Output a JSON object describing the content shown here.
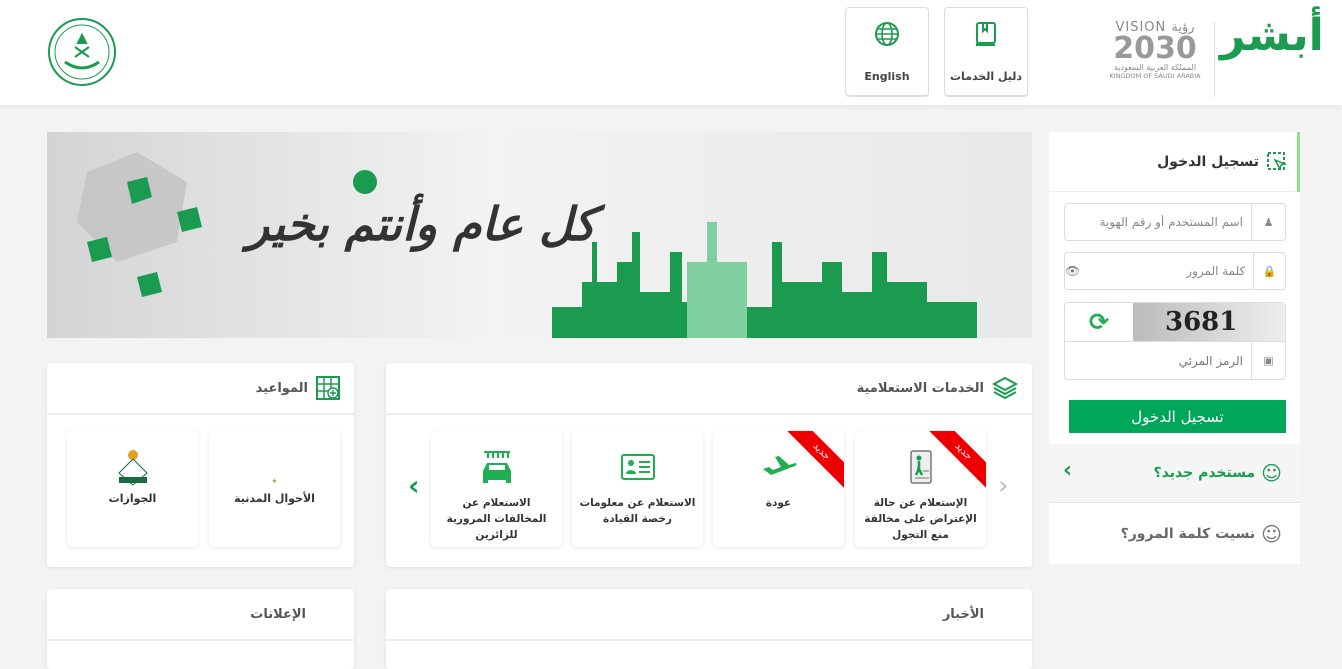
{
  "header": {
    "logo_text": "أبشر",
    "vision_logo": {
      "line1": "VISION رؤية",
      "line2": "2030",
      "line3": "المملكة العربية السعودية",
      "line4": "KINGDOM OF SAUDI ARABIA"
    },
    "services_guide_label": "دليل الخدمات",
    "english_label": "English",
    "accent": "#00a65a"
  },
  "banner": {
    "greeting": "كل عام وأنتم بخير"
  },
  "login": {
    "title": "تسجيل الدخول",
    "username_placeholder": "اسم المستخدم أو رقم الهوية",
    "password_placeholder": "كلمة المرور",
    "captcha_text": "3681",
    "captcha_placeholder": "الرمز المرئي",
    "submit_label": "تسجيل الدخول",
    "new_user_label": "مستخدم جديد؟",
    "forgot_password_label": "نسيت كلمة المرور؟"
  },
  "appointments": {
    "title": "المواعيد",
    "items": [
      {
        "label": "الأحوال المدنية",
        "logo_text": "الأحوال المدنية"
      },
      {
        "label": "الجوازات"
      }
    ]
  },
  "inquiry_services": {
    "title": "الخدمات الاستعلامية",
    "new_badge": "جديد",
    "items": [
      {
        "label": "الإستعلام عن حالة الإعتراض على مخالفة منع التجول",
        "is_new": true,
        "icon": "document-person-icon"
      },
      {
        "label": "عودة",
        "is_new": true,
        "icon": "airplane-icon"
      },
      {
        "label": "الاستعلام عن معلومات رخصة القيادة",
        "is_new": false,
        "icon": "id-card-icon"
      },
      {
        "label": "الاستعلام عن المخالفات المرورية للزائرين",
        "is_new": false,
        "icon": "car-wash-icon"
      }
    ]
  },
  "announcements": {
    "title": "الإعلانات"
  },
  "news": {
    "title": "الأخبار"
  }
}
